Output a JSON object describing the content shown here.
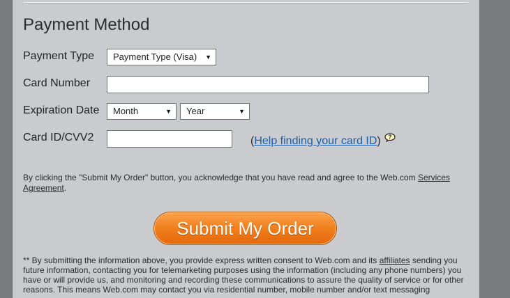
{
  "payment": {
    "heading": "Payment Method",
    "payment_type_label": "Payment Type",
    "payment_type_value": "Payment Type (Visa)",
    "card_number_label": "Card Number",
    "card_number_value": "",
    "expiration_label": "Expiration Date",
    "month_value": "Month",
    "year_value": "Year",
    "cvv_label": "Card ID/CVV2",
    "cvv_value": "",
    "help_open": "(",
    "help_link": "Help finding your card ID",
    "help_close": ")",
    "help_icon": "speech-bubble-question-icon"
  },
  "agreement": {
    "text": "By clicking the \"Submit My Order\" button, you acknowledge that you have read and agree to the Web.com ",
    "link": "Services Agreement",
    "end": "."
  },
  "submit_label": "Submit My Order",
  "fine_print": {
    "part1": "** By submitting the information above, you provide express written consent to Web.com and its ",
    "link": "affiliates",
    "part2": " sending you future information, contacting you for telemarketing purposes using the information (including any phone numbers) you have or will provide us, and monitoring and recording these communications to assure the quality of service or for other reasons. This means Web.com may contact you via residential number, mobile number and/or text messaging"
  },
  "colors": {
    "panel": "#c9cbcf",
    "background": "#7a7b7d",
    "button_orange": "#f2811f",
    "link_blue": "#1d5fa6"
  }
}
